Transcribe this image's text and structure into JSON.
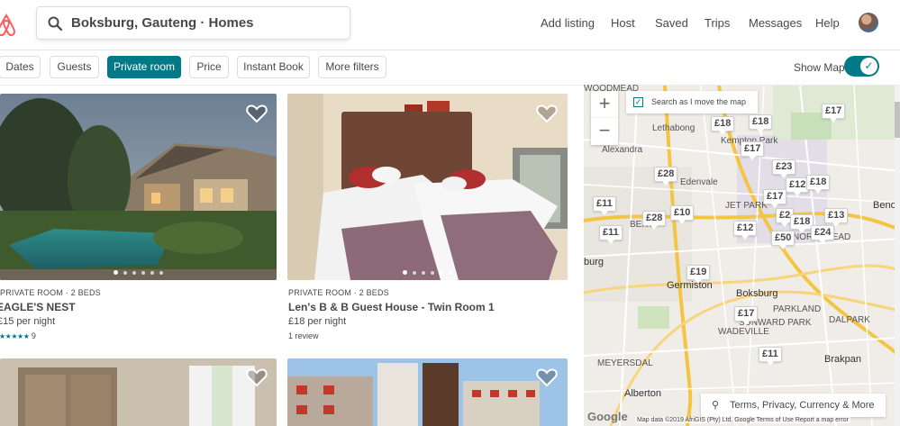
{
  "header": {
    "search_value": "Boksburg, Gauteng · Homes",
    "nav": [
      "Add listing",
      "Host",
      "Saved",
      "Trips",
      "Messages",
      "Help"
    ]
  },
  "filters": {
    "chips": [
      "Dates",
      "Guests",
      "Private room",
      "Price",
      "Instant Book",
      "More filters"
    ],
    "active": "Private room",
    "show_map_label": "Show Map",
    "show_map_on": true,
    "toggle_glyph": "✓"
  },
  "listings": [
    {
      "meta": "PRIVATE ROOM · 2 BEDS",
      "title": "EAGLE'S NEST",
      "price": "£15 per night",
      "stars": "★★★★★",
      "reviews": "9"
    },
    {
      "meta": "PRIVATE ROOM · 2 BEDS",
      "title": "Len's B & B Guest House - Twin Room 1",
      "price": "£18 per night",
      "reviews": "1 review"
    }
  ],
  "map": {
    "zoom_in": "+",
    "zoom_out": "−",
    "search_as_move": "Search as I move the map",
    "search_as_move_checked": true,
    "pins": [
      "£18",
      "£18",
      "£17",
      "£17",
      "£23",
      "£28",
      "£12",
      "£18",
      "£17",
      "£11",
      "£28",
      "£10",
      "£2",
      "£18",
      "£13",
      "£12",
      "£24",
      "£11",
      "£50",
      "£19",
      "£17",
      "£11"
    ],
    "places": [
      "WOODMEAD",
      "Lethabong",
      "Kempton Park",
      "Alexandra",
      "Edenvale",
      "JET PARK",
      "Benoni",
      "Germiston",
      "Boksburg",
      "PARKLAND",
      "DALPARK",
      "WADEVILLE",
      "MEYERSDAL",
      "Brakpan",
      "Alberton",
      "burg",
      "BERT",
      "SUNWARD PARK",
      "NORTHMEAD"
    ],
    "terms": "Terms, Privacy, Currency & More",
    "attribution": "Map data ©2019 AfriGIS (Pty) Ltd, Google   Terms of Use   Report a map error",
    "google": "Google"
  }
}
